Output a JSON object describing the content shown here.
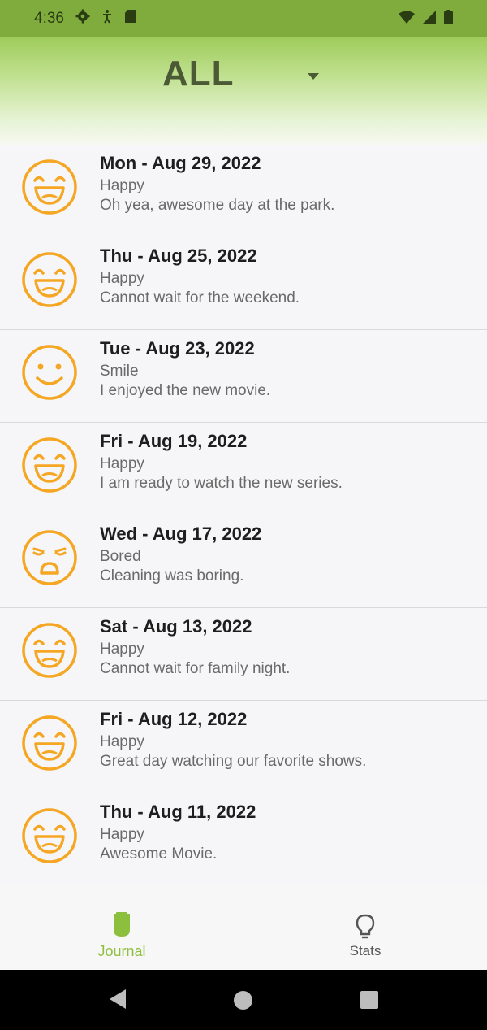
{
  "status_bar": {
    "time": "4:36"
  },
  "header": {
    "filter_label": "ALL"
  },
  "colors": {
    "accent": "#8dbf3f",
    "mood_icon": "#f5a623",
    "status_bar": "#7fac3d"
  },
  "entries": [
    {
      "date": "Mon - Aug 29, 2022",
      "mood": "Happy",
      "note": "Oh yea, awesome day at the park.",
      "icon": "happy-face-icon"
    },
    {
      "date": "Thu - Aug 25, 2022",
      "mood": "Happy",
      "note": "Cannot wait for the weekend.",
      "icon": "happy-face-icon"
    },
    {
      "date": "Tue - Aug 23, 2022",
      "mood": "Smile",
      "note": "I enjoyed the new movie.",
      "icon": "smile-face-icon"
    },
    {
      "date": "Fri - Aug 19, 2022",
      "mood": "Happy",
      "note": "I am ready to watch the new series.",
      "icon": "happy-face-icon"
    },
    {
      "date": "Wed - Aug 17, 2022",
      "mood": "Bored",
      "note": "Cleaning was boring.",
      "icon": "bored-face-icon"
    },
    {
      "date": "Sat - Aug 13, 2022",
      "mood": "Happy",
      "note": "Cannot wait for family night.",
      "icon": "happy-face-icon"
    },
    {
      "date": "Fri - Aug 12, 2022",
      "mood": "Happy",
      "note": "Great day watching our favorite shows.",
      "icon": "happy-face-icon"
    },
    {
      "date": "Thu - Aug 11, 2022",
      "mood": "Happy",
      "note": "Awesome Movie.",
      "icon": "happy-face-icon"
    }
  ],
  "bottom_nav": {
    "journal_label": "Journal",
    "stats_label": "Stats"
  }
}
